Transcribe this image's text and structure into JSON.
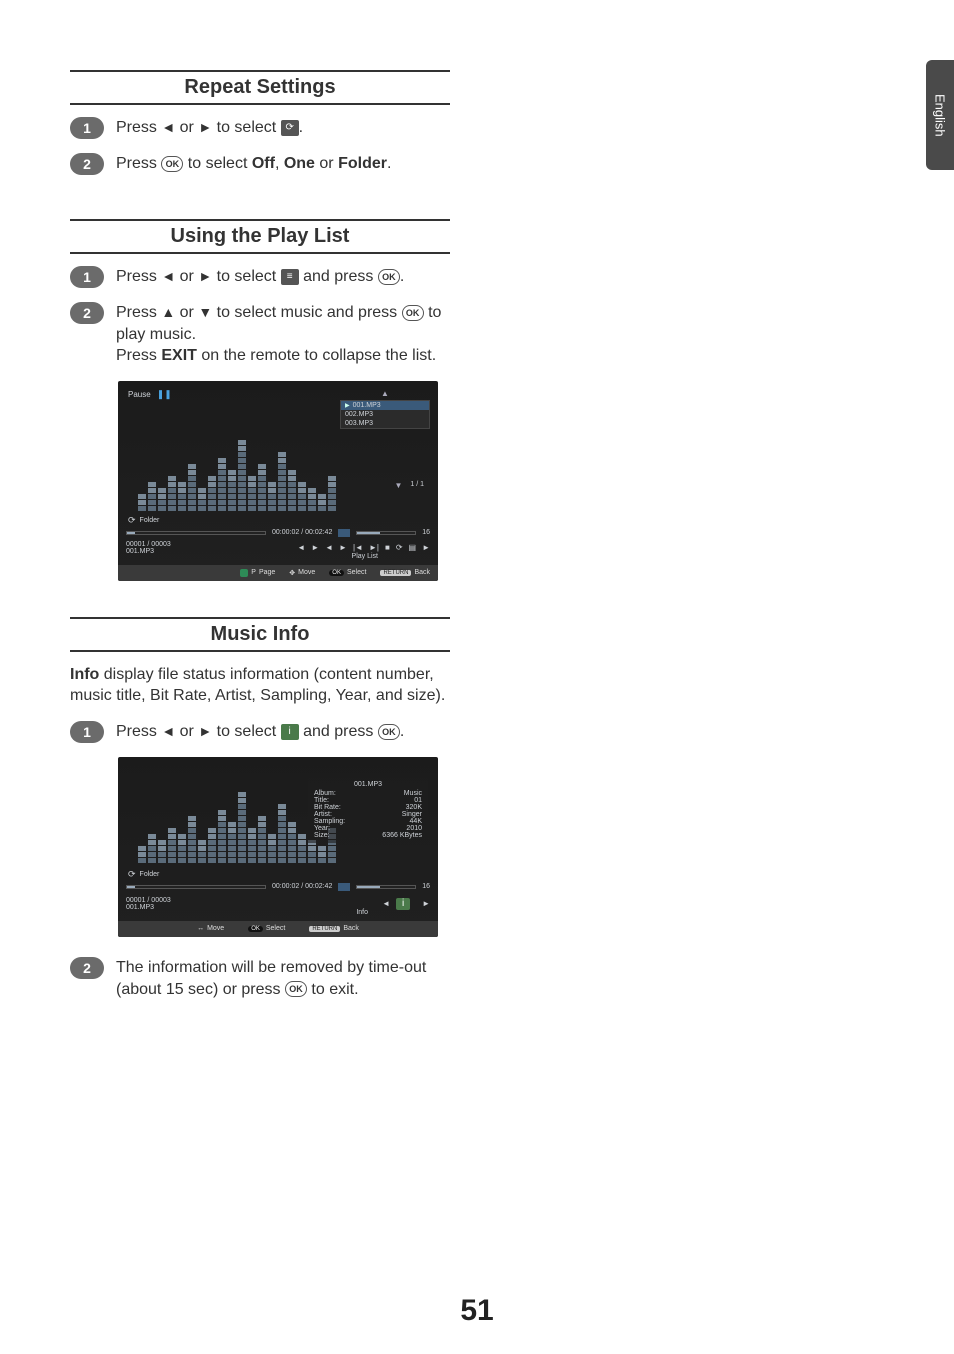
{
  "side_tab": "English",
  "page_number": "51",
  "sections": {
    "repeat": {
      "title": "Repeat Settings",
      "step1_a": "Press ",
      "step1_b": " or ",
      "step1_c": " to select ",
      "step1_d": ".",
      "step2_a": "Press ",
      "step2_b": " to select ",
      "step2_off": "Off",
      "step2_sep1": ", ",
      "step2_one": "One",
      "step2_sep2": " or ",
      "step2_folder": "Folder",
      "step2_end": "."
    },
    "playlist": {
      "title": "Using the Play List",
      "step1_a": "Press ",
      "step1_b": " or ",
      "step1_c": " to select ",
      "step1_d": " and press ",
      "step1_e": ".",
      "step2_a": "Press ",
      "step2_b": " or ",
      "step2_c": " to select music and press ",
      "step2_d": " to play music.",
      "step2_line2a": "Press ",
      "step2_exit": "EXIT",
      "step2_line2b": " on the remote to collapse the list."
    },
    "musicinfo": {
      "title": "Music Info",
      "intro_a": "Info",
      "intro_b": " display file status information (content number, music title, Bit Rate, Artist, Sampling, Year, and size).",
      "step1_a": "Press ",
      "step1_b": " or ",
      "step1_c": " to select ",
      "step1_d": " and press ",
      "step1_e": ".",
      "step2": "The information will be removed by time-out (about 15 sec) or press ",
      "step2_end": " to exit."
    }
  },
  "glyphs": {
    "left": "◄",
    "right": "►",
    "up": "▲",
    "down": "▼",
    "ok": "OK",
    "repeat": "⟳",
    "list": "≡",
    "info": "i"
  },
  "screenshot1": {
    "pause": "Pause",
    "folder_mode": "Folder",
    "playlist": [
      "001.MP3",
      "002.MP3",
      "003.MP3"
    ],
    "page_indicator": "1 / 1",
    "time": "00:00:02 / 00:02:42",
    "volume": "16",
    "count": "00001 / 00003",
    "file": "001.MP3",
    "playlist_label": "Play List",
    "hints": {
      "page": "Page",
      "move": "Move",
      "select": "Select",
      "back": "Back",
      "ok": "OK",
      "return": "RETURN",
      "p": "P"
    }
  },
  "screenshot2": {
    "folder_mode": "Folder",
    "time": "00:00:02 / 00:02:42",
    "volume": "16",
    "count": "00001 / 00003",
    "file": "001.MP3",
    "info_label": "Info",
    "info_header": "001.MP3",
    "info_rows": {
      "Album": "Music",
      "Title": "01",
      "Bit Rate": "320K",
      "Artist": "Singer",
      "Sampling": "44K",
      "Year": "2010",
      "Size": "6366 KBytes"
    },
    "hints": {
      "move": "Move",
      "select": "Select",
      "back": "Back",
      "ok": "OK",
      "return": "RETURN"
    }
  }
}
